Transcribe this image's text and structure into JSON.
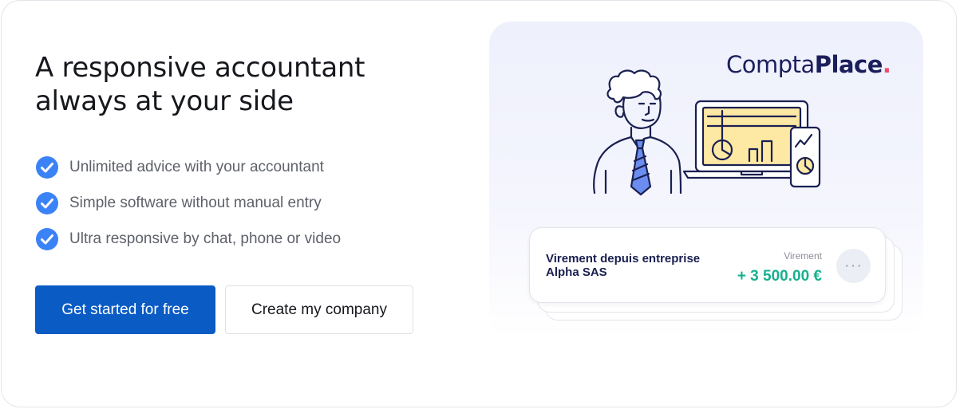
{
  "hero": {
    "title_line1": "A responsive accountant",
    "title_line2": "always at your side"
  },
  "features": [
    {
      "icon": "check-circle-icon",
      "label": "Unlimited advice with your accountant"
    },
    {
      "icon": "check-circle-icon",
      "label": "Simple software without manual entry"
    },
    {
      "icon": "check-circle-icon",
      "label": "Ultra responsive by chat, phone or video"
    }
  ],
  "buttons": {
    "primary": "Get started for free",
    "secondary": "Create my company"
  },
  "brand": {
    "name_regular": "Compta",
    "name_bold": "Place",
    "dot": "."
  },
  "transaction": {
    "title": "Virement depuis entreprise Alpha SAS",
    "label": "Virement",
    "amount": "+ 3 500.00 €",
    "more_icon": "more-horizontal-icon",
    "more_glyph": "···"
  },
  "colors": {
    "primary": "#0a5bc4",
    "check": "#3b82f6",
    "amount": "#17b08f",
    "brand_dot": "#ef4d6a",
    "brand_text": "#1a1f5c"
  }
}
